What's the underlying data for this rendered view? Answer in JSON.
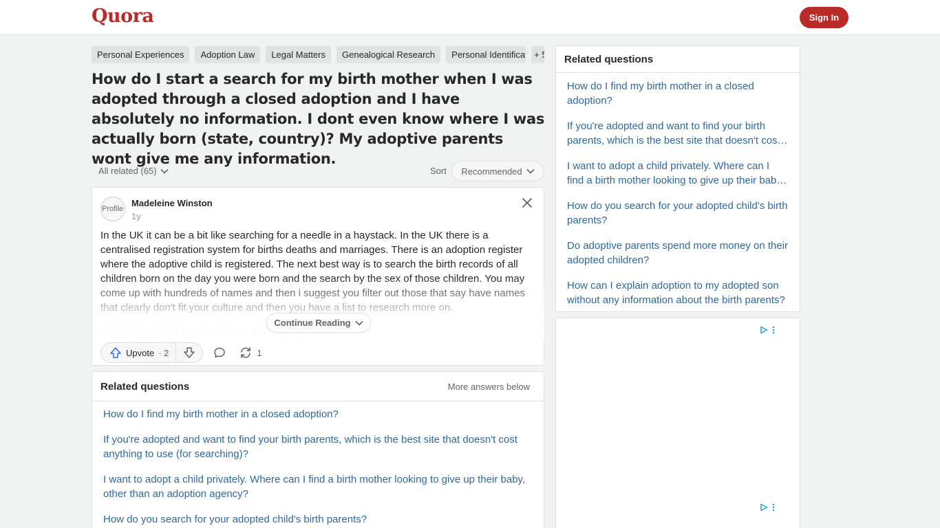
{
  "header": {
    "logo": "Quora",
    "sign_in_label": "Sign In",
    "brand_color": "#b92b27"
  },
  "topics": [
    "Personal Experiences",
    "Adoption Law",
    "Legal Matters",
    "Genealogical Research",
    "Personal Identification",
    "+ 5"
  ],
  "question": {
    "title": "How do I start a search for my birth mother when I was adopted through a closed adoption and I have absolutely no information. I dont even know where I was actually born (state, country)? My adoptive parents wont give me any information."
  },
  "filters": {
    "all_related": "All related (65)",
    "sort_label": "Sort",
    "sort_value": "Recommended"
  },
  "answer": {
    "avatar_alt": "Profile",
    "author": "Madeleine Winston",
    "time": "1y",
    "paragraph_1": "In the UK it can be a bit like searching for a needle in a haystack. In the UK there is a centralised registration system for births deaths and marriages. There is an adoption register where the adoptive child is registered. The next best way is to search the birth records of all children born on the day you were born and the search by the sex of those children. You may come up with hundreds of names and then i suggest you filter out those that say have names that clearly don't fit your culture and then you have a list to research more on.",
    "paragraph_2": "I am sorry your adoptive parents won't give you more info",
    "continue_label": "Continue Reading",
    "upvote_label": "Upvote",
    "upvote_count": "· 2",
    "share_count": "1"
  },
  "related_main": {
    "title": "Related questions",
    "more_label": "More answers below",
    "items": [
      "How do I find my birth mother in a closed adoption?",
      "If you're adopted and want to find your birth parents, which is the best site that doesn't cost anything to use (for searching)?",
      "I want to adopt a child privately. Where can I find a birth mother looking to give up their baby, other than an adoption agency?",
      "How do you search for your adopted child's birth parents?"
    ]
  },
  "sidebar": {
    "title": "Related questions",
    "items": [
      "How do I find my birth mother in a closed adoption?",
      "If you're adopted and want to find your birth parents, which is the best site that doesn't cost anything to use (for searching)?",
      "I want to adopt a child privately. Where can I find a birth mother looking to give up their baby, other than an adoption agency?",
      "How do you search for your adopted child's birth parents?",
      "Do adoptive parents spend more money on their adopted children?",
      "How can I explain adoption to my adopted son without any information about the birth parents?"
    ]
  },
  "icons": {
    "adchoices": "adchoices-icon",
    "ad_menu": "ad-menu-icon"
  }
}
